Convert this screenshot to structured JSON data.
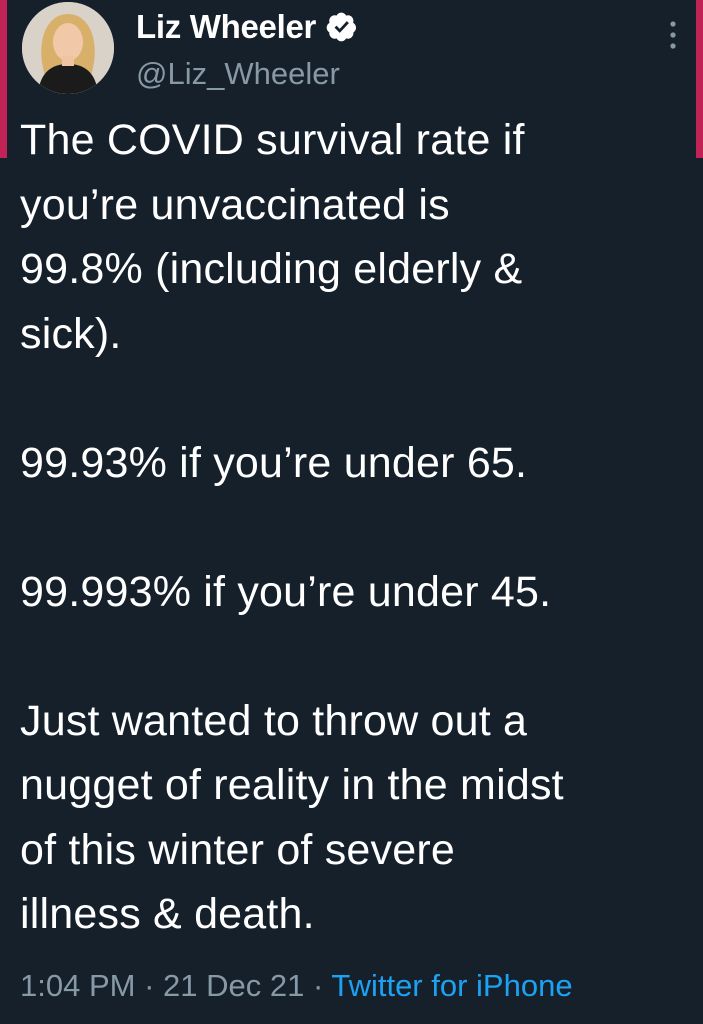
{
  "tweet": {
    "author": {
      "display_name": "Liz Wheeler",
      "handle": "@Liz_Wheeler",
      "verified_icon": "verified-badge-icon",
      "avatar": "avatar"
    },
    "more_icon": "more-vertical-icon",
    "text": "The COVID survival rate if\nyou’re unvaccinated is\n99.8% (including elderly &\nsick).\n\n99.93% if you’re under 65.\n\n99.993% if you’re under 45.\n\nJust wanted to throw out a\nnugget of reality in the midst\nof this winter of severe\nillness & death.",
    "time": "1:04 PM",
    "date": "21 Dec 21",
    "separator": " · ",
    "source": "Twitter for iPhone"
  },
  "colors": {
    "background": "#15202b",
    "text": "#ffffff",
    "secondary_text": "#8899a6",
    "link": "#1da1f2",
    "accent_bar": "#e0245e"
  }
}
